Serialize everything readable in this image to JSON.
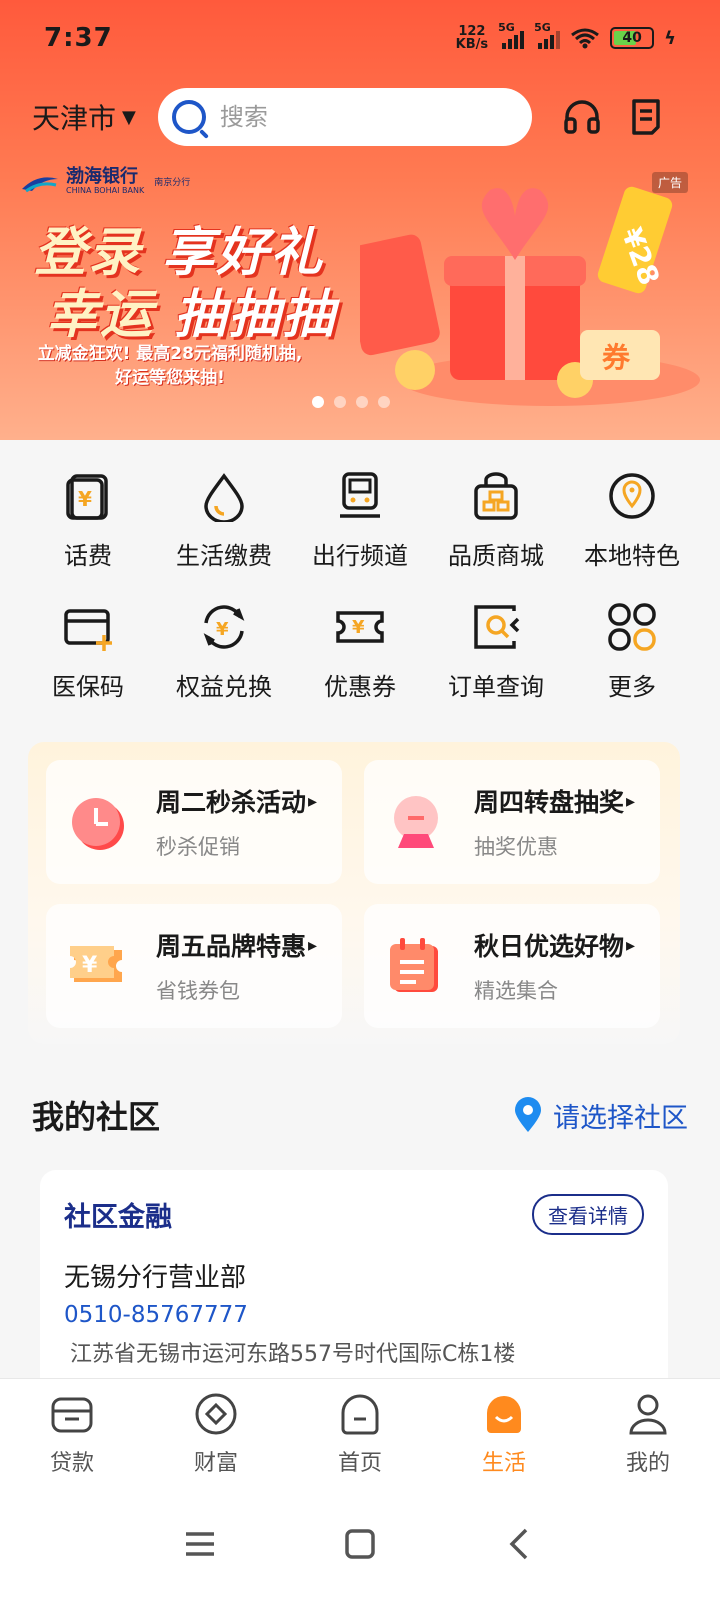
{
  "status_bar": {
    "time": "7:37",
    "net_speed_top": "122",
    "net_speed_bottom": "KB/s",
    "sig1": "5G",
    "sig2": "5G",
    "battery": "40"
  },
  "header": {
    "city": "天津市",
    "search_placeholder": "搜索"
  },
  "banner": {
    "bank_name": "渤海银行",
    "bank_name_en": "CHINA BOHAI BANK",
    "branch": "南京分行",
    "ad_tag": "广告",
    "line1_a": "登录",
    "line1_b": "享好礼",
    "line2_a": "幸运",
    "line2_b": "抽抽抽",
    "sub_1": "立减金狂欢! 最高28元福利随机抽,",
    "sub_2": "好运等您来抽!",
    "coupon_text": "¥28",
    "coupon_tag": "券"
  },
  "grid": [
    {
      "label": "话费"
    },
    {
      "label": "生活缴费"
    },
    {
      "label": "出行频道"
    },
    {
      "label": "品质商城"
    },
    {
      "label": "本地特色"
    },
    {
      "label": "医保码"
    },
    {
      "label": "权益兑换"
    },
    {
      "label": "优惠券"
    },
    {
      "label": "订单查询"
    },
    {
      "label": "更多"
    }
  ],
  "promos": [
    {
      "title": "周二秒杀活动",
      "subtitle": "秒杀促销"
    },
    {
      "title": "周四转盘抽奖",
      "subtitle": "抽奖优惠"
    },
    {
      "title": "周五品牌特惠",
      "subtitle": "省钱券包"
    },
    {
      "title": "秋日优选好物",
      "subtitle": "精选集合"
    }
  ],
  "community": {
    "title": "我的社区",
    "select_label": "请选择社区",
    "card_title": "社区金融",
    "detail_button": "查看详情",
    "branch_name": "无锡分行营业部",
    "phone": "0510-85767777",
    "address": "江苏省无锡市运河东路557号时代国际C栋1楼"
  },
  "bottom_nav": [
    {
      "label": "贷款"
    },
    {
      "label": "财富"
    },
    {
      "label": "首页"
    },
    {
      "label": "生活"
    },
    {
      "label": "我的"
    }
  ],
  "colors": {
    "accent": "#ff8a1e",
    "brand_blue": "#1e56c8",
    "header_red": "#ff5a3c"
  }
}
